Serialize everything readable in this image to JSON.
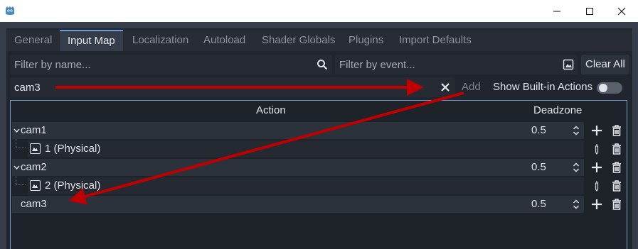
{
  "titlebar": {
    "icons": [
      "godot-icon",
      "minimize-icon",
      "maximize-icon",
      "close-icon"
    ]
  },
  "tabs": [
    {
      "label": "General",
      "active": false
    },
    {
      "label": "Input Map",
      "active": true
    },
    {
      "label": "Localization",
      "active": false
    },
    {
      "label": "Autoload",
      "active": false
    },
    {
      "label": "Shader Globals",
      "active": false
    },
    {
      "label": "Plugins",
      "active": false
    },
    {
      "label": "Import Defaults",
      "active": false
    }
  ],
  "filter": {
    "name_placeholder": "Filter by name...",
    "event_placeholder": "Filter by event...",
    "clear_all_label": "Clear All"
  },
  "add_action": {
    "value": "cam3",
    "add_label": "Add",
    "builtin_label": "Show Built-in Actions",
    "builtin_enabled": false
  },
  "table": {
    "header_action": "Action",
    "header_deadzone": "Deadzone",
    "rows": [
      {
        "kind": "action",
        "label": "cam1",
        "deadzone": "0.5",
        "expanded": true
      },
      {
        "kind": "event",
        "label": "1 (Physical)"
      },
      {
        "kind": "action",
        "label": "cam2",
        "deadzone": "0.5",
        "expanded": true
      },
      {
        "kind": "event",
        "label": "2 (Physical)"
      },
      {
        "kind": "action",
        "label": "cam3",
        "deadzone": "0.5",
        "expanded": false
      }
    ]
  },
  "colors": {
    "accent": "#6e9bd6",
    "annotation_arrow": "#c00000",
    "panel_bg": "#20252e"
  }
}
